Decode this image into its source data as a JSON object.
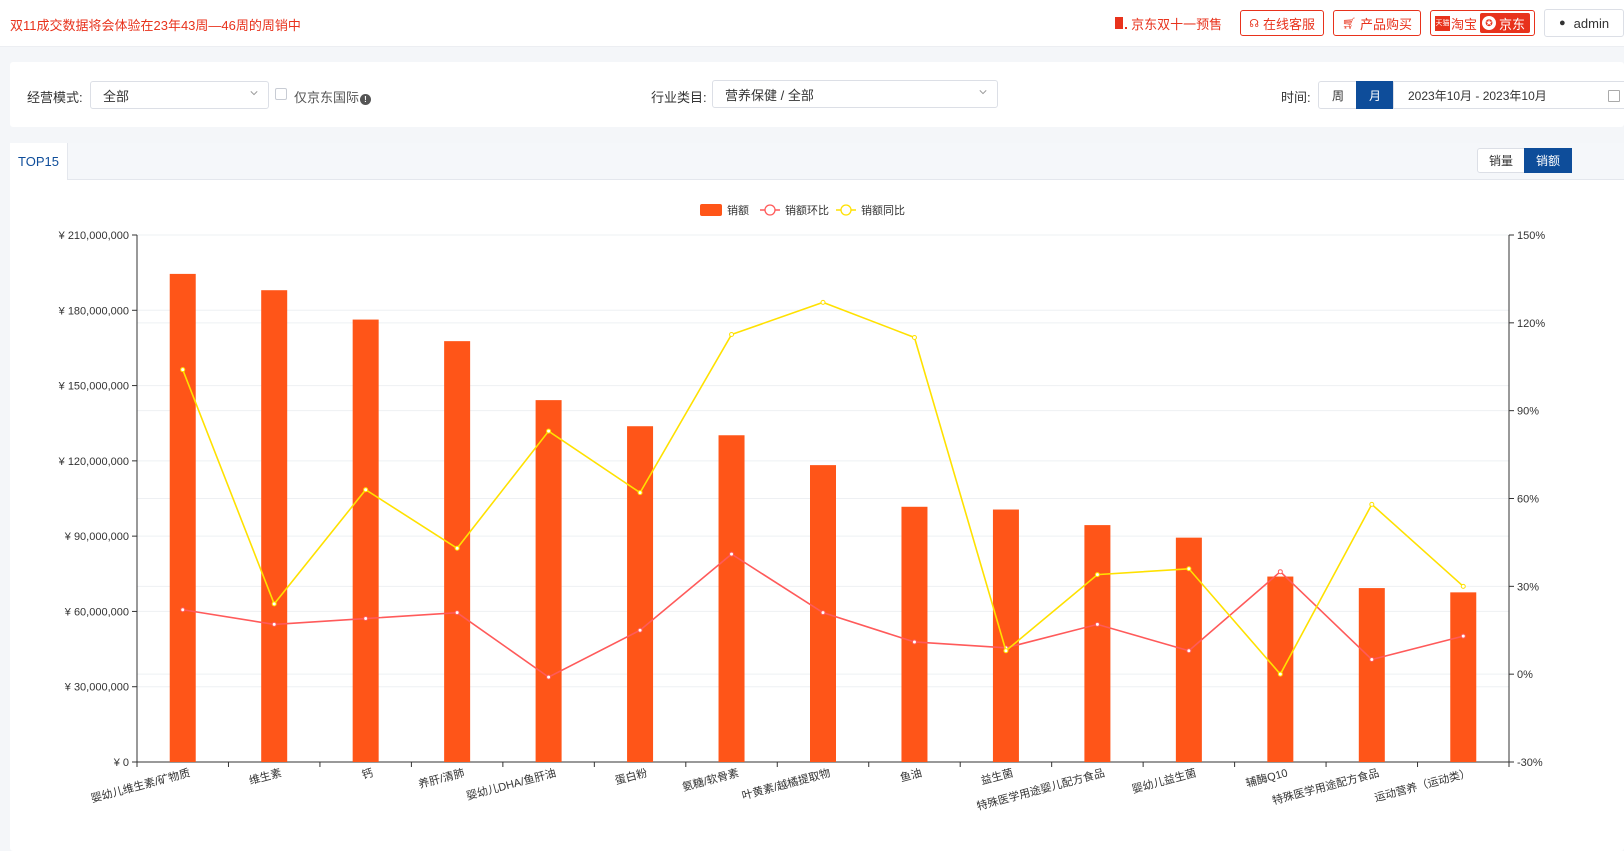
{
  "topbar": {
    "notice": "双11成交数据将会体验在23年43周—46周的周销中",
    "promo_label": "京东双十一预售",
    "service_label": "在线客服",
    "purchase_label": "产品购买",
    "tmall_badge": "天猫",
    "taobao_label": "淘宝",
    "jd_label": "京东",
    "user_label": "admin"
  },
  "filters": {
    "mode_label": "经营模式:",
    "mode_value": "全部",
    "intl_only_label": "仅京东国际",
    "category_label": "行业类目:",
    "category_value": "营养保健 / 全部",
    "time_label": "时间:",
    "period_week": "周",
    "period_month": "月",
    "date_range": "2023年10月 - 2023年10月"
  },
  "panel": {
    "tab_label": "TOP15",
    "metric_qty": "销量",
    "metric_amount": "销额"
  },
  "colors": {
    "bar": "#ff5518",
    "mom_line": "#ff5a5a",
    "yoy_line": "#ffe100",
    "active": "#0e4d9a"
  },
  "chart_data": {
    "type": "bar",
    "categories": [
      "婴幼儿维生素/矿物质",
      "维生素",
      "钙",
      "养肝/清肺",
      "婴幼儿DHA/鱼肝油",
      "蛋白粉",
      "氨糖/软骨素",
      "叶黄素/越橘提取物",
      "鱼油",
      "益生菌",
      "特殊医学用途婴儿配方食品",
      "婴幼儿益生菌",
      "辅酶Q10",
      "特殊医学用途配方食品",
      "运动营养（运动类）"
    ],
    "series": [
      {
        "name": "销额",
        "type": "bar",
        "axis": "left",
        "values": [
          194500000,
          188000000,
          176300000,
          167700000,
          144200000,
          133800000,
          130200000,
          118300000,
          101700000,
          100600000,
          94400000,
          89400000,
          73900000,
          69300000,
          67600000
        ]
      },
      {
        "name": "销额环比",
        "type": "line",
        "axis": "right",
        "values": [
          22,
          17,
          19,
          21,
          -1,
          15,
          41,
          21,
          11,
          9,
          17,
          8,
          35,
          5,
          13
        ]
      },
      {
        "name": "销额同比",
        "type": "line",
        "axis": "right",
        "values": [
          104,
          24,
          63,
          43,
          83,
          62,
          116,
          127,
          115,
          8,
          34,
          36,
          0,
          58,
          30
        ]
      }
    ],
    "y_left": {
      "min": 0,
      "max": 210000000,
      "ticks": [
        "¥ 0",
        "¥ 30,000,000",
        "¥ 60,000,000",
        "¥ 90,000,000",
        "¥ 120,000,000",
        "¥ 150,000,000",
        "¥ 180,000,000",
        "¥ 210,000,000"
      ]
    },
    "y_right": {
      "min": -30,
      "max": 150,
      "ticks": [
        "-30%",
        "0%",
        "30%",
        "60%",
        "90%",
        "120%",
        "150%"
      ]
    },
    "legend_position": "top-center"
  }
}
